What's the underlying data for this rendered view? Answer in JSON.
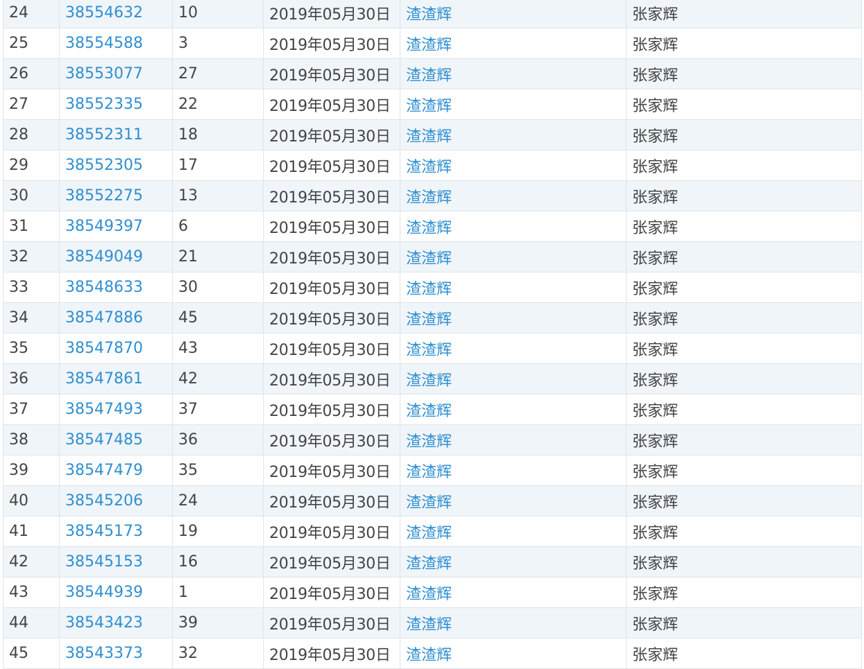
{
  "table": {
    "rows": [
      {
        "num": "24",
        "id": "38554632",
        "floor": "10",
        "date": "2019年05月30日",
        "alias": "渣渣辉",
        "name": "张家辉"
      },
      {
        "num": "25",
        "id": "38554588",
        "floor": "3",
        "date": "2019年05月30日",
        "alias": "渣渣辉",
        "name": "张家辉"
      },
      {
        "num": "26",
        "id": "38553077",
        "floor": "27",
        "date": "2019年05月30日",
        "alias": "渣渣辉",
        "name": "张家辉"
      },
      {
        "num": "27",
        "id": "38552335",
        "floor": "22",
        "date": "2019年05月30日",
        "alias": "渣渣辉",
        "name": "张家辉"
      },
      {
        "num": "28",
        "id": "38552311",
        "floor": "18",
        "date": "2019年05月30日",
        "alias": "渣渣辉",
        "name": "张家辉"
      },
      {
        "num": "29",
        "id": "38552305",
        "floor": "17",
        "date": "2019年05月30日",
        "alias": "渣渣辉",
        "name": "张家辉"
      },
      {
        "num": "30",
        "id": "38552275",
        "floor": "13",
        "date": "2019年05月30日",
        "alias": "渣渣辉",
        "name": "张家辉"
      },
      {
        "num": "31",
        "id": "38549397",
        "floor": "6",
        "date": "2019年05月30日",
        "alias": "渣渣辉",
        "name": "张家辉"
      },
      {
        "num": "32",
        "id": "38549049",
        "floor": "21",
        "date": "2019年05月30日",
        "alias": "渣渣辉",
        "name": "张家辉"
      },
      {
        "num": "33",
        "id": "38548633",
        "floor": "30",
        "date": "2019年05月30日",
        "alias": "渣渣辉",
        "name": "张家辉"
      },
      {
        "num": "34",
        "id": "38547886",
        "floor": "45",
        "date": "2019年05月30日",
        "alias": "渣渣辉",
        "name": "张家辉"
      },
      {
        "num": "35",
        "id": "38547870",
        "floor": "43",
        "date": "2019年05月30日",
        "alias": "渣渣辉",
        "name": "张家辉"
      },
      {
        "num": "36",
        "id": "38547861",
        "floor": "42",
        "date": "2019年05月30日",
        "alias": "渣渣辉",
        "name": "张家辉"
      },
      {
        "num": "37",
        "id": "38547493",
        "floor": "37",
        "date": "2019年05月30日",
        "alias": "渣渣辉",
        "name": "张家辉"
      },
      {
        "num": "38",
        "id": "38547485",
        "floor": "36",
        "date": "2019年05月30日",
        "alias": "渣渣辉",
        "name": "张家辉"
      },
      {
        "num": "39",
        "id": "38547479",
        "floor": "35",
        "date": "2019年05月30日",
        "alias": "渣渣辉",
        "name": "张家辉"
      },
      {
        "num": "40",
        "id": "38545206",
        "floor": "24",
        "date": "2019年05月30日",
        "alias": "渣渣辉",
        "name": "张家辉"
      },
      {
        "num": "41",
        "id": "38545173",
        "floor": "19",
        "date": "2019年05月30日",
        "alias": "渣渣辉",
        "name": "张家辉"
      },
      {
        "num": "42",
        "id": "38545153",
        "floor": "16",
        "date": "2019年05月30日",
        "alias": "渣渣辉",
        "name": "张家辉"
      },
      {
        "num": "43",
        "id": "38544939",
        "floor": "1",
        "date": "2019年05月30日",
        "alias": "渣渣辉",
        "name": "张家辉"
      },
      {
        "num": "44",
        "id": "38543423",
        "floor": "39",
        "date": "2019年05月30日",
        "alias": "渣渣辉",
        "name": "张家辉"
      },
      {
        "num": "45",
        "id": "38543373",
        "floor": "32",
        "date": "2019年05月30日",
        "alias": "渣渣辉",
        "name": "张家辉"
      }
    ]
  },
  "colors": {
    "link": "#2f8fd0",
    "text": "#444444",
    "row_alt_bg": "#f0f5fa",
    "border": "#dfe4ea"
  }
}
